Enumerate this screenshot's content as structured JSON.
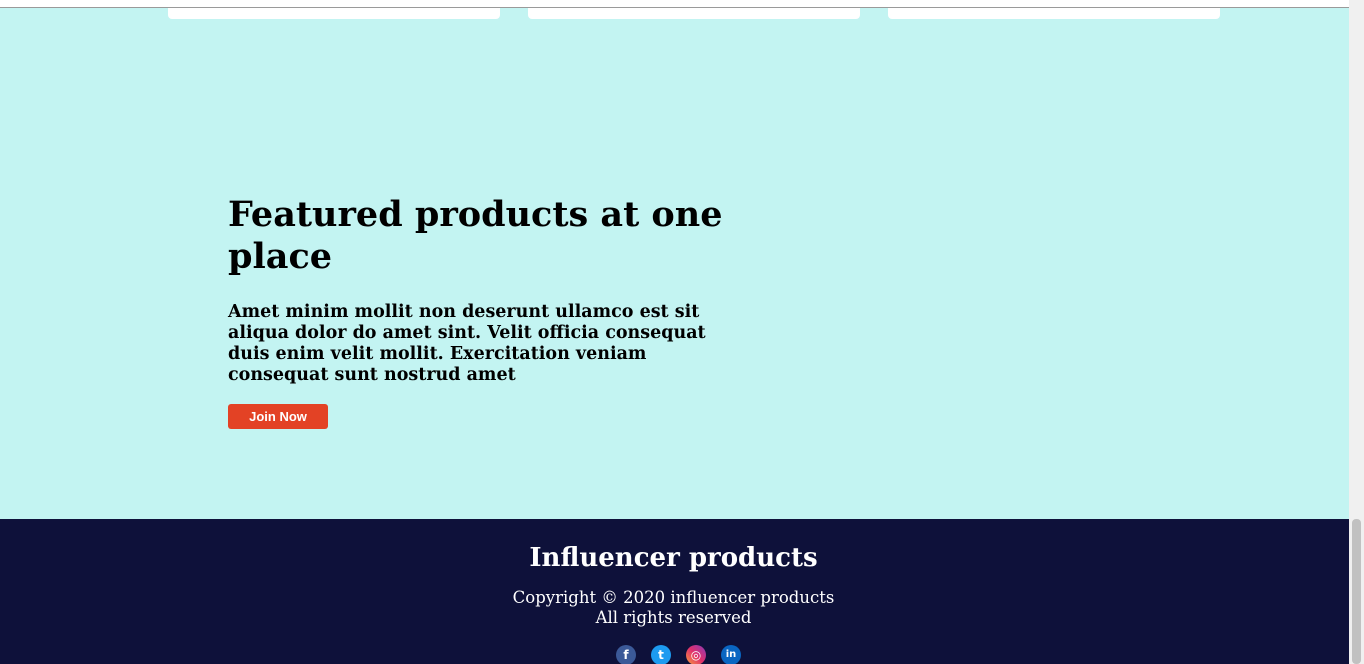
{
  "hero": {
    "title": "Featured products at one place",
    "description": "Amet minim mollit non deserunt ullamco est sit aliqua dolor do amet sint. Velit officia consequat duis enim velit mollit. Exercitation veniam consequat sunt nostrud amet",
    "button_label": "Join Now",
    "background_color": "#c3f4f2",
    "button_color": "#e34225"
  },
  "footer": {
    "title": "Influencer products",
    "copyright": "Copyright © 2020 influencer products",
    "rights": "All rights reserved",
    "background_color": "#0e113a",
    "social": [
      {
        "name": "facebook-icon",
        "glyph": "f"
      },
      {
        "name": "twitter-icon",
        "glyph": "t"
      },
      {
        "name": "instagram-icon",
        "glyph": "◎"
      },
      {
        "name": "linkedin-icon",
        "glyph": "in"
      }
    ]
  }
}
